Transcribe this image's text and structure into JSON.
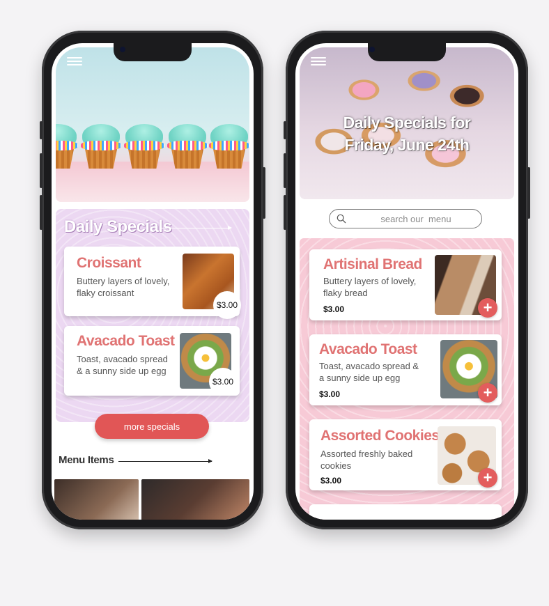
{
  "left_screen": {
    "specials_title": "Daily Specials",
    "specials": [
      {
        "name": "Croissant",
        "description": "Buttery layers of lovely, flaky croissant",
        "price": "$3.00"
      },
      {
        "name": "Avacado Toast",
        "description": "Toast, avacado spread & a sunny side up egg",
        "price": "$3.00"
      }
    ],
    "more_button": "more specials",
    "menu_title": "Menu Items"
  },
  "right_screen": {
    "hero_title_line1": "Daily Specials for",
    "hero_title_line2": "Friday, June 24th",
    "search": {
      "placeholder": "search our  menu"
    },
    "items": [
      {
        "name": "Artisinal Bread",
        "description": "Buttery layers of lovely, flaky bread",
        "price": "$3.00"
      },
      {
        "name": "Avacado Toast",
        "description": "Toast, avacado spread & a sunny side up egg",
        "price": "$3.00"
      },
      {
        "name": "Assorted Cookies",
        "description": "Assorted freshly baked cookies",
        "price": "$3.00"
      }
    ],
    "add_symbol": "+"
  },
  "colors": {
    "accent": "#e15656",
    "item_name": "#e07373",
    "left_panel": "#ecd8f2",
    "right_panel": "#f7cad6"
  }
}
